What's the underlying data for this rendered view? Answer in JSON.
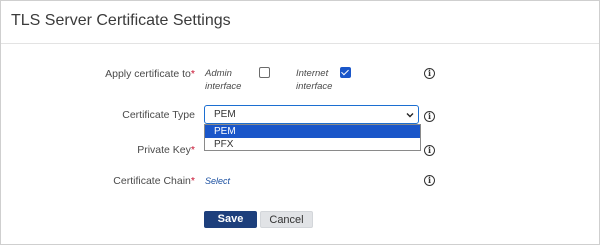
{
  "dialog": {
    "title": "TLS Server Certificate Settings"
  },
  "apply_certificate": {
    "label": "Apply certificate to",
    "required_mark": "*",
    "options": [
      {
        "label_line1": "Admin",
        "label_line2": "interface",
        "checked": false
      },
      {
        "label_line1": "Internet",
        "label_line2": "interface",
        "checked": true
      }
    ]
  },
  "certificate_type": {
    "label": "Certificate Type",
    "selected": "PEM",
    "options": [
      "PEM",
      "PFX"
    ],
    "highlighted_option": "PEM"
  },
  "private_key": {
    "label": "Private Key",
    "required_mark": "*"
  },
  "certificate_chain": {
    "label": "Certificate Chain",
    "required_mark": "*",
    "select_link": "Select"
  },
  "buttons": {
    "save": "Save",
    "cancel": "Cancel"
  },
  "icons": {
    "info": "info-icon",
    "dropdown": "chevron-down-icon"
  },
  "colors": {
    "primary_button": "#1d3f7c",
    "highlight": "#1a56c9",
    "required": "#c8102e",
    "focus_border": "#1c6fd1"
  }
}
